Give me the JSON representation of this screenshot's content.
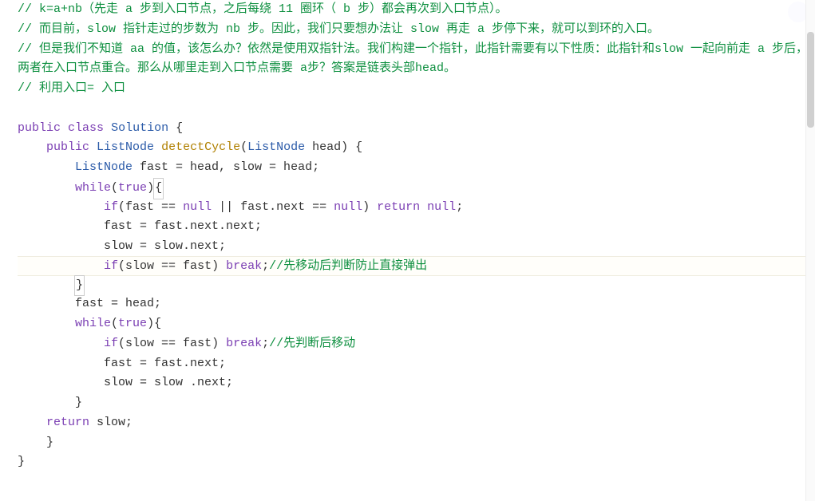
{
  "code": {
    "lines": [
      {
        "indent": 0,
        "tokens": [
          {
            "t": "comment",
            "v": "// k=a+nb（先走 a 步到入口节点，之后每绕 11 圈环（ b 步）都会再次到入口节点）。"
          }
        ]
      },
      {
        "indent": 0,
        "tokens": [
          {
            "t": "comment",
            "v": "// 而目前，slow 指针走过的步数为 nb 步。因此，我们只要想办法让 slow 再走 a 步停下来，就可以到环的入口。"
          }
        ]
      },
      {
        "indent": 0,
        "tokens": [
          {
            "t": "comment",
            "v": "// 但是我们不知道 aa 的值，该怎么办？依然是使用双指针法。我们构建一个指针，此指针需要有以下性质：此指针和slow 一起向前走 a 步后，两者在入口节点重合。那么从哪里走到入口节点需要 a步？答案是链表头部head。"
          }
        ],
        "wrap": true
      },
      {
        "indent": 0,
        "tokens": [
          {
            "t": "comment",
            "v": "// 利用入口= 入口"
          }
        ]
      },
      {
        "indent": 0,
        "tokens": []
      },
      {
        "indent": 0,
        "tokens": [
          {
            "t": "keyword",
            "v": "public"
          },
          {
            "t": "plain",
            "v": " "
          },
          {
            "t": "keyword",
            "v": "class"
          },
          {
            "t": "plain",
            "v": " "
          },
          {
            "t": "type",
            "v": "Solution"
          },
          {
            "t": "plain",
            "v": " {"
          }
        ]
      },
      {
        "indent": 4,
        "tokens": [
          {
            "t": "keyword",
            "v": "public"
          },
          {
            "t": "plain",
            "v": " "
          },
          {
            "t": "type",
            "v": "ListNode"
          },
          {
            "t": "plain",
            "v": " "
          },
          {
            "t": "method",
            "v": "detectCycle"
          },
          {
            "t": "plain",
            "v": "("
          },
          {
            "t": "type",
            "v": "ListNode"
          },
          {
            "t": "plain",
            "v": " head) {"
          }
        ]
      },
      {
        "indent": 8,
        "tokens": [
          {
            "t": "type",
            "v": "ListNode"
          },
          {
            "t": "plain",
            "v": " fast = head, slow = head;"
          }
        ]
      },
      {
        "indent": 8,
        "tokens": [
          {
            "t": "keyword",
            "v": "while"
          },
          {
            "t": "plain",
            "v": "("
          },
          {
            "t": "keyword",
            "v": "true"
          },
          {
            "t": "plain",
            "v": ")"
          },
          {
            "t": "plain",
            "v": "{",
            "box": true
          }
        ]
      },
      {
        "indent": 12,
        "tokens": [
          {
            "t": "keyword",
            "v": "if"
          },
          {
            "t": "plain",
            "v": "(fast == "
          },
          {
            "t": "keyword",
            "v": "null"
          },
          {
            "t": "plain",
            "v": " || fast.next == "
          },
          {
            "t": "keyword",
            "v": "null"
          },
          {
            "t": "plain",
            "v": ") "
          },
          {
            "t": "keyword",
            "v": "return"
          },
          {
            "t": "plain",
            "v": " "
          },
          {
            "t": "keyword",
            "v": "null"
          },
          {
            "t": "plain",
            "v": ";"
          }
        ]
      },
      {
        "indent": 12,
        "tokens": [
          {
            "t": "plain",
            "v": "fast = fast.next.next;"
          }
        ]
      },
      {
        "indent": 12,
        "tokens": [
          {
            "t": "plain",
            "v": "slow = slow.next;"
          }
        ]
      },
      {
        "indent": 12,
        "tokens": [
          {
            "t": "keyword",
            "v": "if"
          },
          {
            "t": "plain",
            "v": "(slow == fast) "
          },
          {
            "t": "keyword",
            "v": "break"
          },
          {
            "t": "plain",
            "v": ";"
          },
          {
            "t": "comment",
            "v": "//先移动后判断防止直接弹出"
          }
        ],
        "hl": true
      },
      {
        "indent": 8,
        "tokens": [
          {
            "t": "plain",
            "v": "}",
            "box": true
          }
        ]
      },
      {
        "indent": 8,
        "tokens": [
          {
            "t": "plain",
            "v": "fast = head;"
          }
        ]
      },
      {
        "indent": 8,
        "tokens": [
          {
            "t": "keyword",
            "v": "while"
          },
          {
            "t": "plain",
            "v": "("
          },
          {
            "t": "keyword",
            "v": "true"
          },
          {
            "t": "plain",
            "v": "){"
          }
        ]
      },
      {
        "indent": 12,
        "tokens": [
          {
            "t": "keyword",
            "v": "if"
          },
          {
            "t": "plain",
            "v": "(slow == fast) "
          },
          {
            "t": "keyword",
            "v": "break"
          },
          {
            "t": "plain",
            "v": ";"
          },
          {
            "t": "comment",
            "v": "//先判断后移动"
          }
        ]
      },
      {
        "indent": 12,
        "tokens": [
          {
            "t": "plain",
            "v": "fast = fast.next;"
          }
        ]
      },
      {
        "indent": 12,
        "tokens": [
          {
            "t": "plain",
            "v": "slow = slow .next;"
          }
        ]
      },
      {
        "indent": 8,
        "tokens": [
          {
            "t": "plain",
            "v": "}"
          }
        ]
      },
      {
        "indent": 4,
        "tokens": [
          {
            "t": "keyword",
            "v": "return"
          },
          {
            "t": "plain",
            "v": " slow;"
          }
        ]
      },
      {
        "indent": 4,
        "tokens": [
          {
            "t": "plain",
            "v": "}"
          }
        ]
      },
      {
        "indent": 0,
        "tokens": [
          {
            "t": "plain",
            "v": "}"
          }
        ]
      }
    ]
  }
}
